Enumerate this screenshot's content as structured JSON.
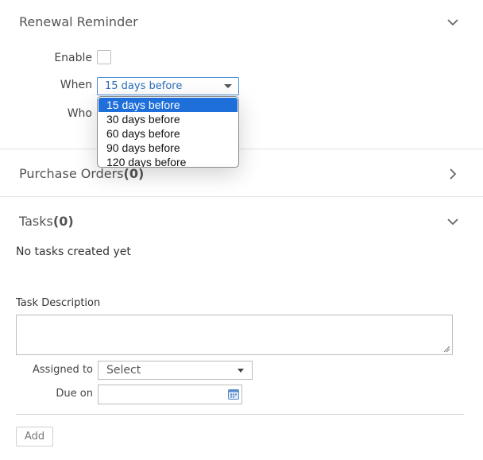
{
  "renewal": {
    "title": "Renewal Reminder",
    "enable_label": "Enable",
    "when_label": "When",
    "when_value": "15 days before",
    "who_label": "Who",
    "options": [
      "15 days before",
      "30 days before",
      "60 days before",
      "90 days before",
      "120 days before"
    ],
    "selected_index": 0
  },
  "purchase_orders": {
    "title": "Purchase Orders",
    "count": "(0)"
  },
  "tasks": {
    "title": "Tasks",
    "count": "(0)",
    "empty_text": "No tasks created yet",
    "description_label": "Task Description",
    "assigned_label": "Assigned to",
    "assigned_value": "Select",
    "due_label": "Due on",
    "add_label": "Add"
  },
  "icons": {
    "renewal_toggle": "chevron-down-icon",
    "purchase_toggle": "chevron-right-icon",
    "tasks_toggle": "chevron-down-icon",
    "calendar": "calendar-icon"
  },
  "colors": {
    "accent": "#1e6fd9",
    "select_text": "#2a6ebb"
  }
}
